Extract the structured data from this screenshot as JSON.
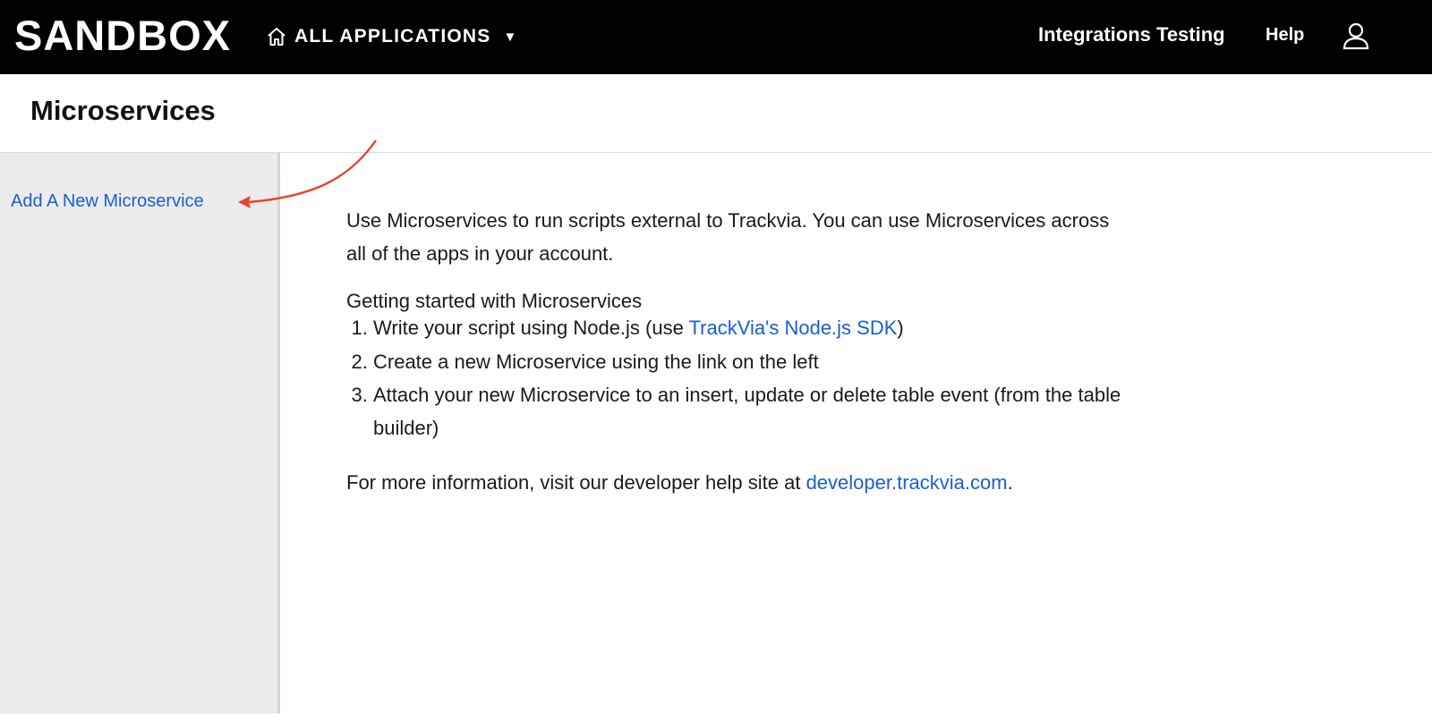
{
  "header": {
    "brand": "SANDBOX",
    "apps_label": "ALL APPLICATIONS",
    "apps_caret": "▼",
    "account_name": "Integrations Testing",
    "help_label": "Help",
    "background_color": "#000000"
  },
  "page": {
    "title": "Microservices"
  },
  "sidebar": {
    "add_link": "Add A New Microservice",
    "background_color": "#ececec"
  },
  "annotation": {
    "arrow_color": "#e8432c"
  },
  "content": {
    "intro": "Use Microservices to run scripts external to Trackvia. You can use Microservices across all of the apps in your account.",
    "steps_heading": "Getting started with Microservices",
    "steps": [
      {
        "before": "Write your script using Node.js (use ",
        "link": "TrackVia's Node.js SDK",
        "after": ")"
      },
      {
        "text": "Create a new Microservice using the link on the left"
      },
      {
        "text": "Attach your new Microservice to an insert, update or delete table event (from the table builder)"
      }
    ],
    "more_info_before": "For more information, visit our developer help site at ",
    "more_info_link": "developer.trackvia.com",
    "more_info_after": ".",
    "link_color": "#1a5fd0"
  }
}
